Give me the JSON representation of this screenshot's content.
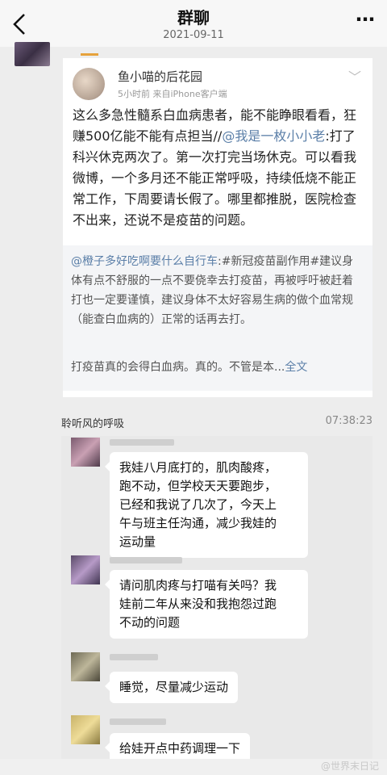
{
  "header": {
    "title": "群聊",
    "date": "2021-09-11",
    "more_icon": "⋯"
  },
  "post": {
    "author": "鱼小喵的后花园",
    "meta": "5小时前  来自iPhone客户端",
    "text_part1": "这么多急性髓系白血病患者，能不能睁眼看看，狂赚500亿能不能有点担当//",
    "mention1": "@我是一枚小小老",
    "text_part2": ":打了科兴休克两次了。第一次打完当场休克。可以看我微博，一个多月还不能正常呼吸，持续低烧不能正常工作，下周要请长假了。哪里都推脱，医院检查不出来，还说不是疫苗的问题。",
    "repost": {
      "mention": "@橙子多好吃啊要什么自行车",
      "text": ":#新冠疫苗副作用#建议身体有点不舒服的一点不要侥幸去打疫苗，再被呼吁被赶着打也一定要谨慎，建议身体不太好容易生病的做个血常规（能查白血病的）正常的话再去打。",
      "more_text": "打疫苗真的会得白血病。真的。不管是本...",
      "fulltext": "全文"
    }
  },
  "chat": {
    "sender": "聆听风的呼吸",
    "time": "07:38:23",
    "messages": [
      "我娃八月底打的，肌肉酸疼，\n跑不动，但学校天天要跑步，\n已经和我说了几次了，今天上\n午与班主任沟通，减少我娃的\n运动量",
      "请问肌肉疼与打喵有关吗？我\n娃前二年从来没和我抱怨过跑\n不动的问题",
      "睡觉，尽量减少运动",
      "给娃开点中药调理一下"
    ]
  },
  "watermark": "@世界末日记"
}
